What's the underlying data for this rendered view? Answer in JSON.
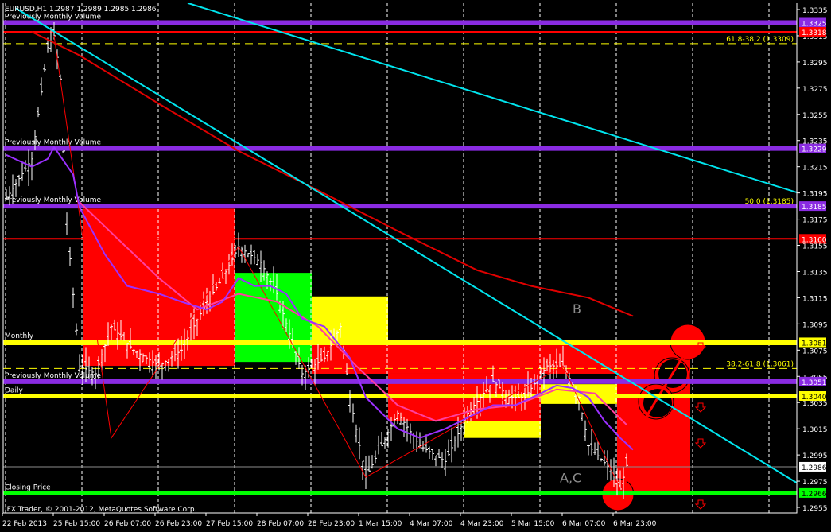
{
  "window": {
    "symbol_header": "EURUSD,H1  1.2987 1.2989 1.2985 1.2986",
    "copyright": "IFX Trader, © 2001-2012, MetaQuotes Software Corp."
  },
  "colors": {
    "background": "#000000",
    "axis": "#ffffff",
    "purple": "#8a2be2",
    "red": "#ff0000",
    "yellow": "#ffff00",
    "green": "#00ff00",
    "cyan": "#00e5ee",
    "pink": "#ff3fa0",
    "gray": "#8c8c8c"
  },
  "chart_data": {
    "type": "ohlc",
    "title": "EURUSD,H1",
    "ylim": [
      1.2945,
      1.3342
    ],
    "xlim": [
      0,
      250
    ],
    "y_ticks": [
      "1.3335",
      "1.3315",
      "1.3295",
      "1.3275",
      "1.3255",
      "1.3235",
      "1.3215",
      "1.3195",
      "1.3175",
      "1.3155",
      "1.3135",
      "1.3115",
      "1.3095",
      "1.3075",
      "1.3055",
      "1.3035",
      "1.3015",
      "1.2995",
      "1.2975",
      "1.2955"
    ],
    "x_ticks": [
      {
        "label": "22 Feb 2013",
        "bar": 0
      },
      {
        "label": "25 Feb 15:00",
        "bar": 16
      },
      {
        "label": "26 Feb 07:00",
        "bar": 32
      },
      {
        "label": "26 Feb 23:00",
        "bar": 48
      },
      {
        "label": "27 Feb 15:00",
        "bar": 64
      },
      {
        "label": "28 Feb 07:00",
        "bar": 80
      },
      {
        "label": "28 Feb 23:00",
        "bar": 96
      },
      {
        "label": "1 Mar 15:00",
        "bar": 112
      },
      {
        "label": "4 Mar 07:00",
        "bar": 128
      },
      {
        "label": "4 Mar 23:00",
        "bar": 144
      },
      {
        "label": "5 Mar 15:00",
        "bar": 160
      },
      {
        "label": "6 Mar 07:00",
        "bar": 176
      },
      {
        "label": "6 Mar 23:00",
        "bar": 192
      }
    ],
    "price_path": [
      [
        1,
        1.3191
      ],
      [
        9,
        1.3221
      ],
      [
        14,
        1.3306
      ],
      [
        16,
        1.3315
      ],
      [
        18,
        1.3282
      ],
      [
        20,
        1.3172
      ],
      [
        24,
        1.3063
      ],
      [
        29,
        1.3057
      ],
      [
        34,
        1.3093
      ],
      [
        41,
        1.3075
      ],
      [
        49,
        1.3063
      ],
      [
        56,
        1.3075
      ],
      [
        64,
        1.3112
      ],
      [
        69,
        1.313
      ],
      [
        74,
        1.3154
      ],
      [
        81,
        1.3142
      ],
      [
        86,
        1.3118
      ],
      [
        94,
        1.3057
      ],
      [
        101,
        1.3069
      ],
      [
        106,
        1.3093
      ],
      [
        109,
        1.3039
      ],
      [
        114,
        1.2978
      ],
      [
        119,
        1.3002
      ],
      [
        124,
        1.3027
      ],
      [
        131,
        1.3002
      ],
      [
        139,
        1.299
      ],
      [
        146,
        1.3027
      ],
      [
        154,
        1.3051
      ],
      [
        159,
        1.3039
      ],
      [
        164,
        1.3039
      ],
      [
        171,
        1.3063
      ],
      [
        176,
        1.3063
      ],
      [
        181,
        1.3039
      ],
      [
        184,
        1.3002
      ],
      [
        191,
        1.2984
      ],
      [
        194,
        1.2969
      ],
      [
        196,
        1.2987
      ]
    ],
    "current_price": "1.2986",
    "levels": [
      {
        "price": 1.3325,
        "label": "1.3325",
        "color": "#8a2be2",
        "width": 6,
        "text": "Previously Monthly Volume"
      },
      {
        "price": 1.3318,
        "label": "1.3318",
        "color": "#ff0000",
        "width": 2
      },
      {
        "price": 1.3309,
        "color": "#ffff00",
        "width": 1,
        "dashed": true,
        "right_text": "61.8-38.2 (1.3309)"
      },
      {
        "price": 1.3229,
        "label": "1.3229",
        "color": "#8a2be2",
        "width": 6,
        "text": "Previously Monthly Volume"
      },
      {
        "price": 1.3185,
        "label": "1.3185",
        "color": "#8a2be2",
        "width": 6,
        "text": "Previously Monthly Volume",
        "right_text": "50.0 (1.3185)"
      },
      {
        "price": 1.316,
        "label": "1.3160",
        "color": "#ff0000",
        "width": 2
      },
      {
        "price": 1.3081,
        "label": "1.3081",
        "color": "#ffff00",
        "width": 7,
        "text": "Monthly"
      },
      {
        "price": 1.3061,
        "color": "#ffff00",
        "width": 1,
        "dashed": true,
        "right_text": "38.2-61.8 (1.3061)"
      },
      {
        "price": 1.3051,
        "label": "1.3051",
        "color": "#8a2be2",
        "width": 6,
        "text": "Previously Monthly Volume"
      },
      {
        "price": 1.304,
        "label": "1.3040",
        "color": "#ffff00",
        "width": 5,
        "text": "Daily"
      },
      {
        "price": 1.2986,
        "label": "1.2986",
        "color": "#8c8c8c",
        "width": 1,
        "label_bg": "#ffffff"
      },
      {
        "price": 1.2966,
        "label": "1.2966",
        "color": "#00ff00",
        "width": 5,
        "text": "Closing Price"
      }
    ],
    "zones": [
      {
        "from": 25,
        "to": 73,
        "top": 1.3183,
        "bottom": 1.3063,
        "color": "#ff0000"
      },
      {
        "from": 73,
        "to": 97,
        "top": 1.3134,
        "bottom": 1.3066,
        "color": "#00ff00"
      },
      {
        "from": 97,
        "to": 121,
        "top": 1.3116,
        "bottom": 1.3063,
        "color": "#ffff00"
      },
      {
        "from": 97,
        "to": 216,
        "top": 1.3081,
        "bottom": 1.3057,
        "color": "#ff0000"
      },
      {
        "from": 121,
        "to": 169,
        "top": 1.3057,
        "bottom": 1.3021,
        "color": "#ff0000"
      },
      {
        "from": 145,
        "to": 169,
        "top": 1.3021,
        "bottom": 1.3008,
        "color": "#ffff00"
      },
      {
        "from": 169,
        "to": 193,
        "top": 1.3049,
        "bottom": 1.3034,
        "color": "#ffff00"
      },
      {
        "from": 193,
        "to": 216,
        "top": 1.3075,
        "bottom": 1.2967,
        "color": "#ff0000"
      }
    ],
    "trendlines": [
      {
        "from": [
          58,
          1.334
        ],
        "to": [
          250,
          1.3195
        ],
        "color": "#00e5ee"
      },
      {
        "from": [
          4,
          1.3336
        ],
        "to": [
          250,
          1.2973
        ],
        "color": "#00e5ee"
      }
    ],
    "moving_averages": [
      {
        "name": "slow-ma",
        "color": "#e00000",
        "points": [
          [
            9,
            1.3318
          ],
          [
            24,
            1.33
          ],
          [
            49,
            1.3263
          ],
          [
            74,
            1.3227
          ],
          [
            99,
            1.3197
          ],
          [
            124,
            1.3166
          ],
          [
            149,
            1.3136
          ],
          [
            166,
            1.3124
          ],
          [
            184,
            1.3115
          ],
          [
            198,
            1.3101
          ]
        ]
      },
      {
        "name": "fast-ma",
        "color": "#ff3fa0",
        "points": [
          [
            24,
            1.3188
          ],
          [
            36,
            1.316
          ],
          [
            49,
            1.313
          ],
          [
            61,
            1.3106
          ],
          [
            74,
            1.3118
          ],
          [
            86,
            1.3112
          ],
          [
            99,
            1.3093
          ],
          [
            111,
            1.3063
          ],
          [
            124,
            1.3033
          ],
          [
            136,
            1.3021
          ],
          [
            149,
            1.303
          ],
          [
            161,
            1.3033
          ],
          [
            174,
            1.3045
          ],
          [
            186,
            1.3042
          ],
          [
            196,
            1.3018
          ]
        ]
      },
      {
        "name": "mid-ma",
        "color": "#9b30ff",
        "points": [
          [
            1,
            1.3224
          ],
          [
            9,
            1.3215
          ],
          [
            14,
            1.3221
          ],
          [
            16,
            1.323
          ],
          [
            22,
            1.3209
          ],
          [
            24,
            1.3184
          ],
          [
            32,
            1.3148
          ],
          [
            39,
            1.3124
          ],
          [
            49,
            1.3118
          ],
          [
            56,
            1.3112
          ],
          [
            64,
            1.3106
          ],
          [
            69,
            1.3112
          ],
          [
            74,
            1.313
          ],
          [
            79,
            1.3124
          ],
          [
            84,
            1.3124
          ],
          [
            89,
            1.3118
          ],
          [
            94,
            1.3099
          ],
          [
            101,
            1.3093
          ],
          [
            109,
            1.3069
          ],
          [
            114,
            1.3039
          ],
          [
            119,
            1.3027
          ],
          [
            124,
            1.3015
          ],
          [
            131,
            1.3008
          ],
          [
            139,
            1.3015
          ],
          [
            144,
            1.3021
          ],
          [
            149,
            1.3027
          ],
          [
            154,
            1.3033
          ],
          [
            161,
            1.3033
          ],
          [
            169,
            1.3042
          ],
          [
            174,
            1.3048
          ],
          [
            179,
            1.3046
          ],
          [
            184,
            1.3039
          ],
          [
            189,
            1.3021
          ],
          [
            194,
            1.3008
          ],
          [
            198,
            1.2999
          ]
        ]
      }
    ],
    "annotations": [
      {
        "text": "B",
        "bar": 179,
        "price": 1.3103
      },
      {
        "text": "A,C",
        "bar": 175,
        "price": 1.2974
      }
    ]
  }
}
